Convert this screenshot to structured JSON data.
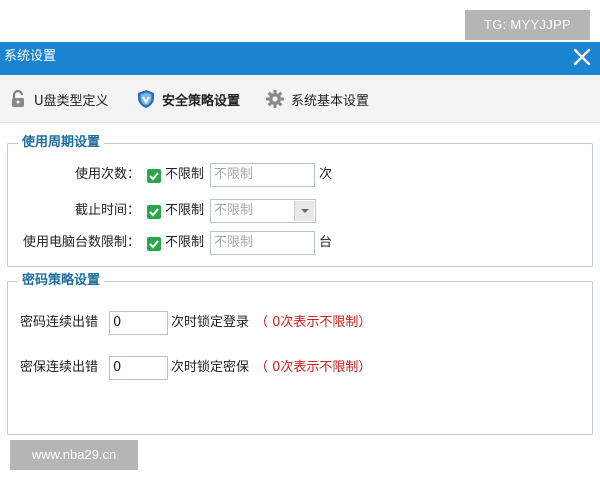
{
  "watermark_top": "TG: MYYJJPP",
  "watermark_bottom": "www.nba29.cn",
  "window": {
    "title": "系统设置"
  },
  "tabs": [
    {
      "label": "U盘类型定义",
      "icon": "lock-icon"
    },
    {
      "label": "安全策略设置",
      "icon": "shield-icon",
      "active": true
    },
    {
      "label": "系统基本设置",
      "icon": "gear-icon"
    }
  ],
  "usage_period": {
    "title": "使用周期设置",
    "rows": [
      {
        "label": "使用次数：",
        "checkbox_label": "不限制",
        "checked": true,
        "input_value": "不限制",
        "unit": "次"
      },
      {
        "label": "截止时间：",
        "checkbox_label": "不限制",
        "checked": true,
        "input_value": "不限制"
      },
      {
        "label": "使用电脑台数限制：",
        "checkbox_label": "不限制",
        "checked": true,
        "input_value": "不限制",
        "unit": "台"
      }
    ]
  },
  "password_policy": {
    "title": "密码策略设置",
    "rows": [
      {
        "label": "密码连续出错",
        "value": "0",
        "suffix": "次时锁定登录",
        "note": "（ 0次表示不限制）"
      },
      {
        "label": "密保连续出错",
        "value": "0",
        "suffix": "次时锁定密保",
        "note": "（ 0次表示不限制）"
      }
    ]
  },
  "colors": {
    "titlebar": "#1a84d0",
    "accent_green": "#2aa54a",
    "legend": "#1f6f9e",
    "note_red": "#d21f1f"
  }
}
